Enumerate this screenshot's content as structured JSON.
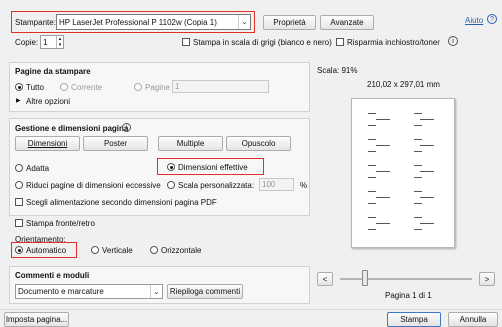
{
  "printer": {
    "label": "Stampante:",
    "selected": "HP LaserJet Professional P 1102w (Copia 1)",
    "properties_button": "Proprietà",
    "advanced_button": "Avanzate",
    "help_link": "Aiuto"
  },
  "copies": {
    "label": "Copie:",
    "value": "1",
    "grayscale_label": "Stampa in scala di grigi (bianco e nero)",
    "save_ink_label": "Risparmia inchiostro/toner"
  },
  "pages": {
    "title": "Pagine da stampare",
    "all_label": "Tutto",
    "current_label": "Corrente",
    "pages_label": "Pagine",
    "pages_value": "1",
    "more_options_label": "Altre opzioni"
  },
  "sizing": {
    "title": "Gestione e dimensioni pagina",
    "btn_size": "Dimensioni",
    "btn_poster": "Poster",
    "btn_multiple": "Multiple",
    "btn_booklet": "Opuscolo",
    "fit_label": "Adatta",
    "actual_label": "Dimensioni effettive",
    "shrink_label": "Riduci pagine di dimensioni eccessive",
    "custom_scale_label": "Scala personalizzata:",
    "custom_scale_value": "100",
    "percent": "%",
    "paper_source_label": "Scegli alimentazione secondo dimensioni pagina PDF"
  },
  "duplex": {
    "label": "Stampa fronte/retro"
  },
  "orientation": {
    "title": "Orientamento:",
    "auto_label": "Automatico",
    "portrait_label": "Verticale",
    "landscape_label": "Orizzontale"
  },
  "comments": {
    "title": "Commenti e moduli",
    "selected": "Documento e marcature",
    "summary_button": "Riepiloga commenti"
  },
  "preview": {
    "scale_label": "Scala:  91%",
    "dimensions": "210,02 x 297,01 mm",
    "page_info": "Pagina 1 di 1",
    "prev_label": "<",
    "next_label": ">"
  },
  "footer": {
    "page_setup_button": "Imposta pagina...",
    "print_button": "Stampa",
    "cancel_button": "Annulla"
  }
}
